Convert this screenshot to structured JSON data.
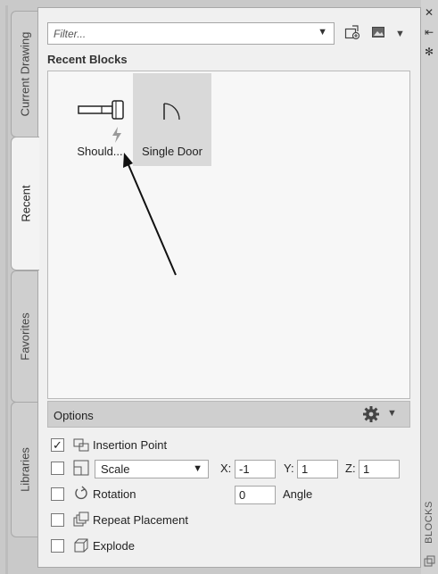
{
  "tabs": {
    "current_drawing": "Current Drawing",
    "recent": "Recent",
    "favorites": "Favorites",
    "libraries": "Libraries"
  },
  "toolbar": {
    "filter_placeholder": "Filter...",
    "dropdown_glyph": "▼",
    "caret_glyph": "▾",
    "icons": [
      "add-block-icon",
      "thumbnail-view-icon"
    ]
  },
  "recent": {
    "section_title": "Recent Blocks",
    "blocks": [
      {
        "label": "Should...",
        "icon": "shoulder-bolt-icon",
        "selected": false
      },
      {
        "label": "Single Door",
        "icon": "door-icon",
        "selected": true
      }
    ]
  },
  "options": {
    "header": "Options",
    "insertion_point": {
      "label": "Insertion Point",
      "checked": true
    },
    "scale": {
      "checked": false,
      "mode": "Scale",
      "x_label": "X:",
      "x_value": "-1",
      "y_label": "Y:",
      "y_value": "1",
      "z_label": "Z:",
      "z_value": "1"
    },
    "rotation": {
      "label": "Rotation",
      "checked": false,
      "angle_value": "0",
      "angle_label": "Angle"
    },
    "repeat_placement": {
      "label": "Repeat Placement",
      "checked": false
    },
    "explode": {
      "label": "Explode",
      "checked": false
    }
  },
  "side": {
    "close_glyph": "✕",
    "auto_hide_glyph": "⇤",
    "props_glyph": "✻",
    "palette_title": "BLOCKS"
  },
  "colors": {
    "selected_tile": "#d9d9d9",
    "panel_bg": "#f0f0f0",
    "options_header": "#cfcfcf"
  }
}
